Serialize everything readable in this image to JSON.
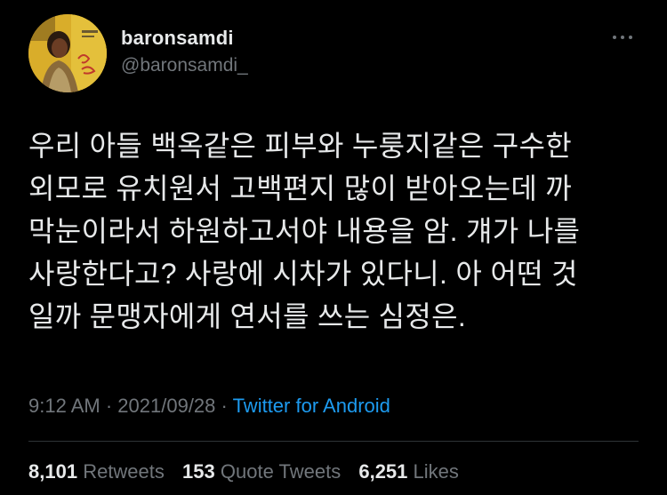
{
  "colors": {
    "background": "#000000",
    "primary_text": "#e7e9ea",
    "secondary_text": "#71767b",
    "link": "#1d9bf0",
    "divider": "#2f3336"
  },
  "author": {
    "display_name": "baronsamdi",
    "handle": "@baronsamdi_",
    "avatar_icon": "album-cover-avatar"
  },
  "more_icon": "more-horizontal-icon",
  "tweet": {
    "lines": [
      "우리 아들 백옥같은 피부와 누룽지같은 구수한",
      "외모로 유치원서 고백편지 많이 받아오는데 까",
      "막눈이라서 하원하고서야 내용을 암. 걔가 나를",
      "사랑한다고? 사랑에 시차가 있다니. 아 어떤 것",
      "일까 문맹자에게 연서를 쓰는 심정은."
    ]
  },
  "meta": {
    "time": "9:12 AM",
    "separator": "·",
    "date": "2021/09/28",
    "source": "Twitter for Android"
  },
  "stats": [
    {
      "count": "8,101",
      "label": "Retweets"
    },
    {
      "count": "153",
      "label": "Quote Tweets"
    },
    {
      "count": "6,251",
      "label": "Likes"
    }
  ]
}
